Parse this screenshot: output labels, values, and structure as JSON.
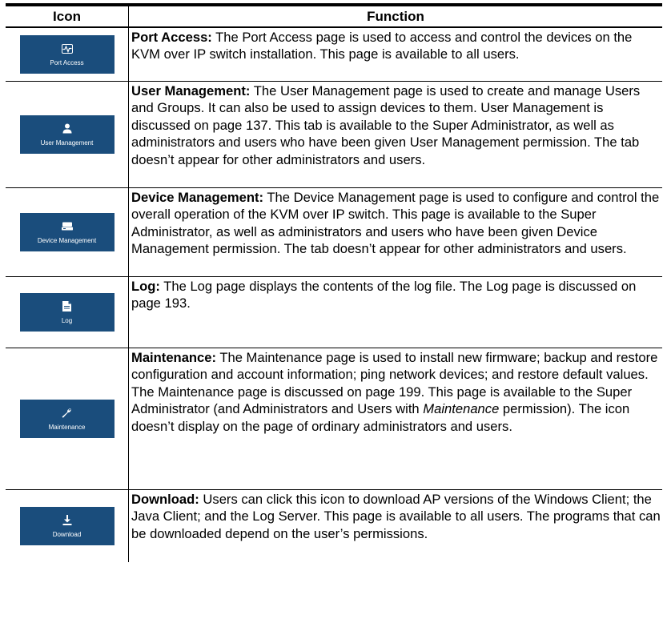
{
  "table": {
    "headers": {
      "icon": "Icon",
      "function": "Function"
    },
    "rows": [
      {
        "icon_name": "port-access-icon",
        "icon_label": "Port Access",
        "title": "Port Access:",
        "text": " The Port Access page is used to access and control the devices on the KVM over IP switch installation. This page is available to all users."
      },
      {
        "icon_name": "user-icon",
        "icon_label": "User Management",
        "title": "User Management:",
        "text": " The User Management page is used to create and manage Users and Groups. It can also be used to assign devices to them. User Management is discussed on page 137. This tab is available to the Super Administrator, as well as administrators and users who have been given User Management permission. The tab doesn’t appear for other administrators and users."
      },
      {
        "icon_name": "device-icon",
        "icon_label": "Device Management",
        "title": "Device Management:",
        "text": " The Device Management page is used to configure and control the overall operation of the KVM over IP switch. This page is available to the Super Administrator, as well as administrators and users who have been given Device Management permission. The tab doesn’t appear for other administrators and users."
      },
      {
        "icon_name": "log-file-icon",
        "icon_label": "Log",
        "title": "Log:",
        "text": " The Log page displays the contents of the log file. The Log page is discussed on page 193."
      },
      {
        "icon_name": "wrench-icon",
        "icon_label": "Maintenance",
        "title": "Maintenance:",
        "text_before": " The Maintenance page is used to install new firmware; backup and restore configuration and account information; ping network devices; and restore default values. The Maintenance page is discussed on page 199. This page is available to the Super Administrator (and Administrators and Users with ",
        "text_italic": "Maintenance",
        "text_after": " permission). The icon doesn’t display on the page of ordinary administrators and users."
      },
      {
        "icon_name": "download-icon",
        "icon_label": "Download",
        "title": "Download:",
        "text": " Users can click this icon to download AP versions of the Windows Client; the Java Client; and the Log Server. This page is available to all users. The programs that can be downloaded depend on the user’s permissions."
      }
    ]
  },
  "colors": {
    "tile": "#1a4d7c",
    "tile_text": "#ffffff"
  }
}
